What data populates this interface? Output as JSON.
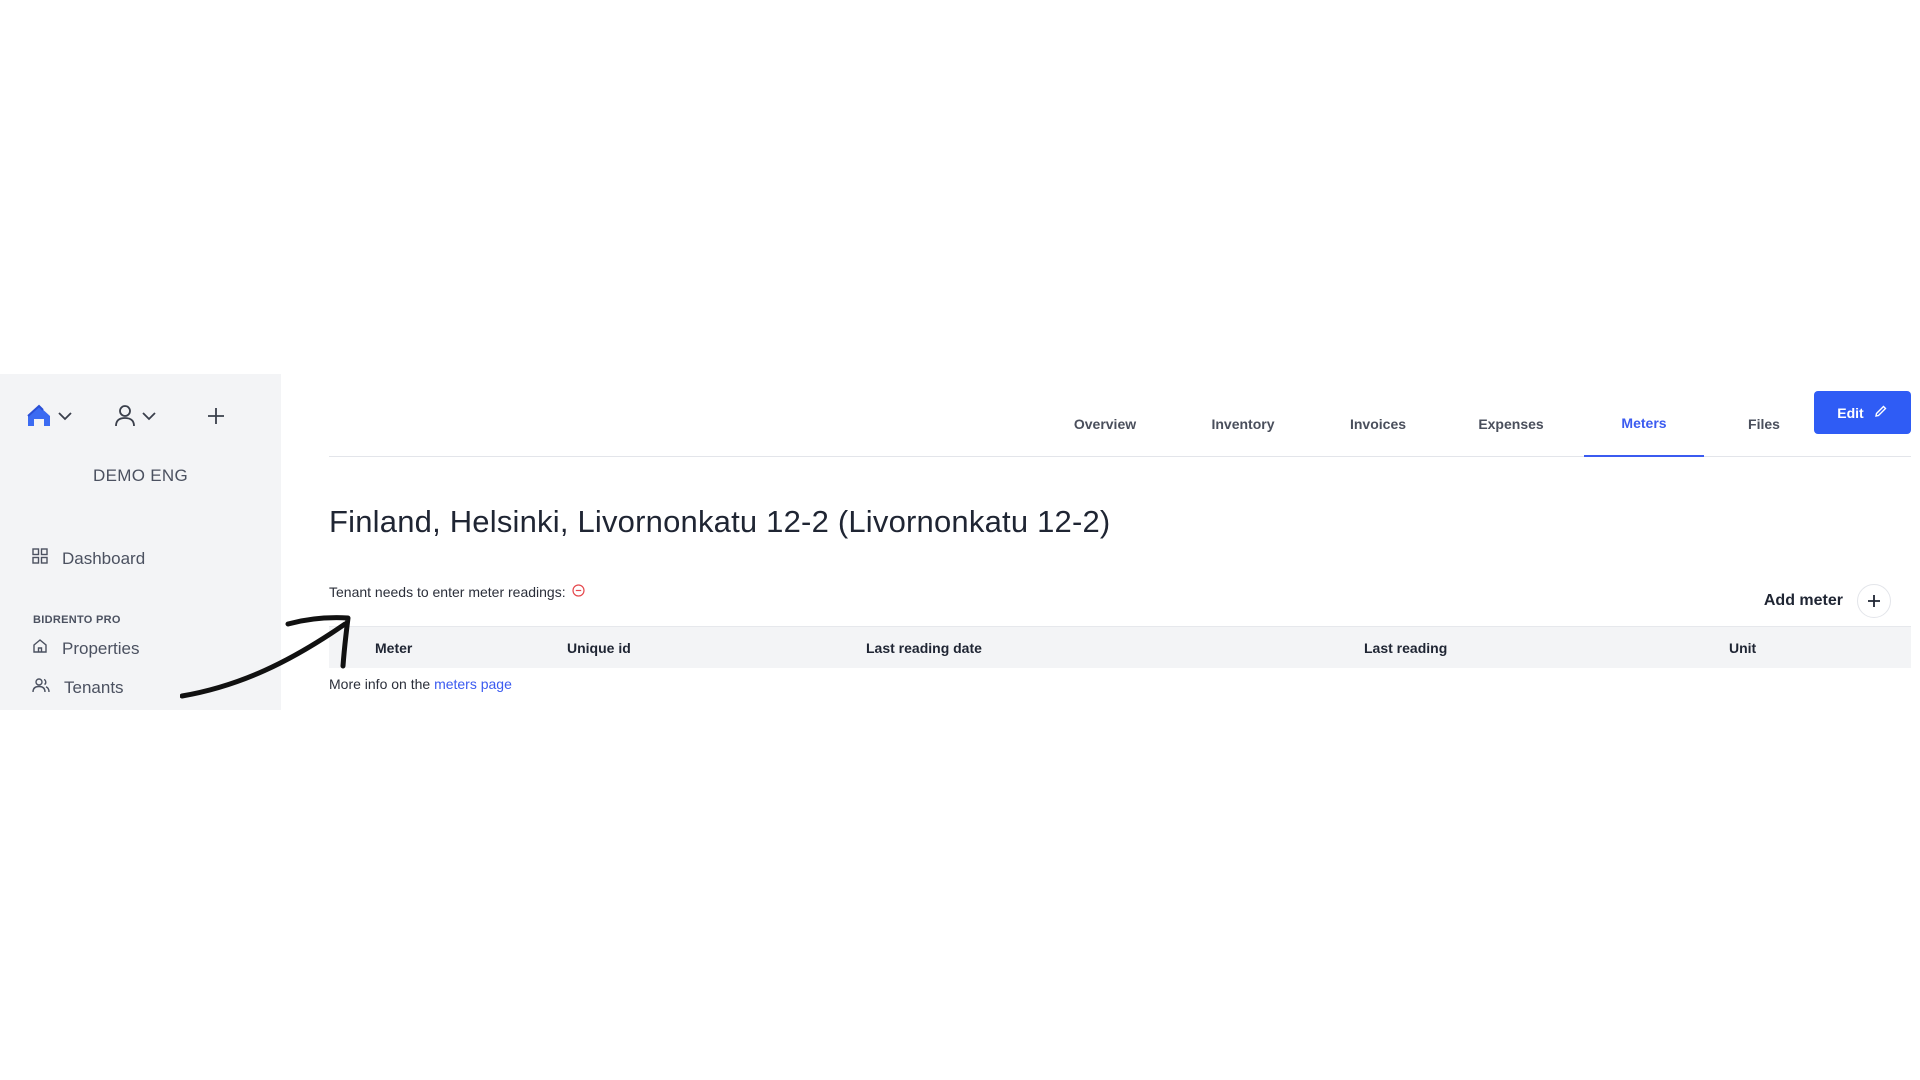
{
  "sidebar": {
    "org_name": "DEMO ENG",
    "section_label": "BIDRENTO PRO",
    "items": [
      {
        "label": "Dashboard",
        "icon": "dashboard-grid-icon"
      },
      {
        "label": "Properties",
        "icon": "home-icon"
      },
      {
        "label": "Tenants",
        "icon": "users-icon"
      }
    ],
    "top_icons": [
      "home-logo-icon",
      "user-icon",
      "plus-icon"
    ]
  },
  "tabs": [
    {
      "label": "Overview",
      "active": false
    },
    {
      "label": "Inventory",
      "active": false
    },
    {
      "label": "Invoices",
      "active": false
    },
    {
      "label": "Expenses",
      "active": false
    },
    {
      "label": "Meters",
      "active": true
    },
    {
      "label": "Files",
      "active": false
    }
  ],
  "edit_button": {
    "label": "Edit",
    "icon": "pencil-icon"
  },
  "page_title": "Finland, Helsinki, Livornonkatu 12-2 (Livornonkatu 12-2)",
  "tenant_note": {
    "text": "Tenant needs to enter meter readings:",
    "status_icon": "minus-circle-icon"
  },
  "add_meter": {
    "label": "Add meter",
    "icon": "plus-icon"
  },
  "table": {
    "columns": [
      "Meter",
      "Unique id",
      "Last reading date",
      "Last reading",
      "Unit"
    ]
  },
  "more_info": {
    "prefix": "More info on the",
    "link": "meters page"
  },
  "colors": {
    "accent": "#3b5bf0",
    "button": "#2f5cf5",
    "sidebar_bg": "#f3f4f6",
    "status_red": "#e5484d"
  }
}
